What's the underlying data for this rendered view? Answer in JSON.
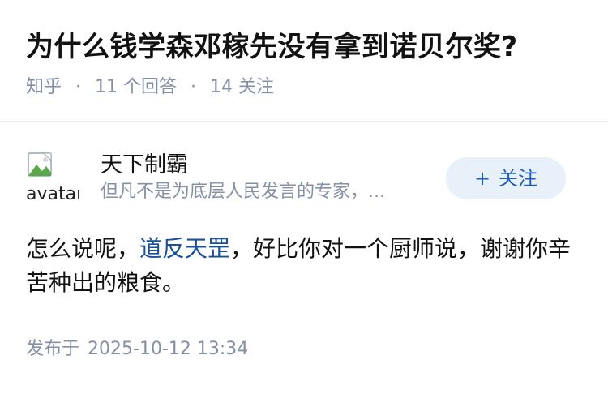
{
  "question": {
    "title": "为什么钱学森邓稼先没有拿到诺贝尔奖?",
    "source": "知乎",
    "answers_count": "11",
    "answers_label": "个回答",
    "follows_count": "14",
    "follows_label": "关注"
  },
  "answer": {
    "author": {
      "name": "天下制霸",
      "bio": "但凡不是为底层人民发言的专家，...",
      "avatar_alt": "avatar"
    },
    "follow_button": {
      "plus": "+",
      "label": "关注"
    },
    "body": {
      "part1": "怎么说呢，",
      "link": "道反天罡",
      "part2": "，好比你对一个厨师说，谢谢你辛苦种出的粮食。"
    },
    "published_label": "发布于",
    "published_time": "2025-10-12 13:34"
  }
}
